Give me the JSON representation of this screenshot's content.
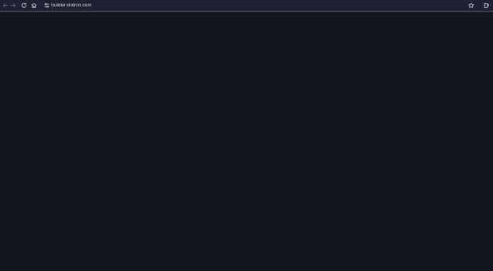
{
  "browser": {
    "url": "builder.niotron.com",
    "buttons": {
      "back": "back-arrow-icon",
      "forward": "forward-arrow-icon",
      "reload": "reload-icon",
      "home": "home-icon",
      "site_info": "tune-icon",
      "bookmark": "star-icon",
      "extensions": "extensions-icon"
    }
  },
  "colors": {
    "toolbar": "#1d2131",
    "page_background": "#13161f",
    "icon": "#c8cbd6",
    "icon_disabled": "#5c6070",
    "url_text": "#e3e5ec"
  }
}
